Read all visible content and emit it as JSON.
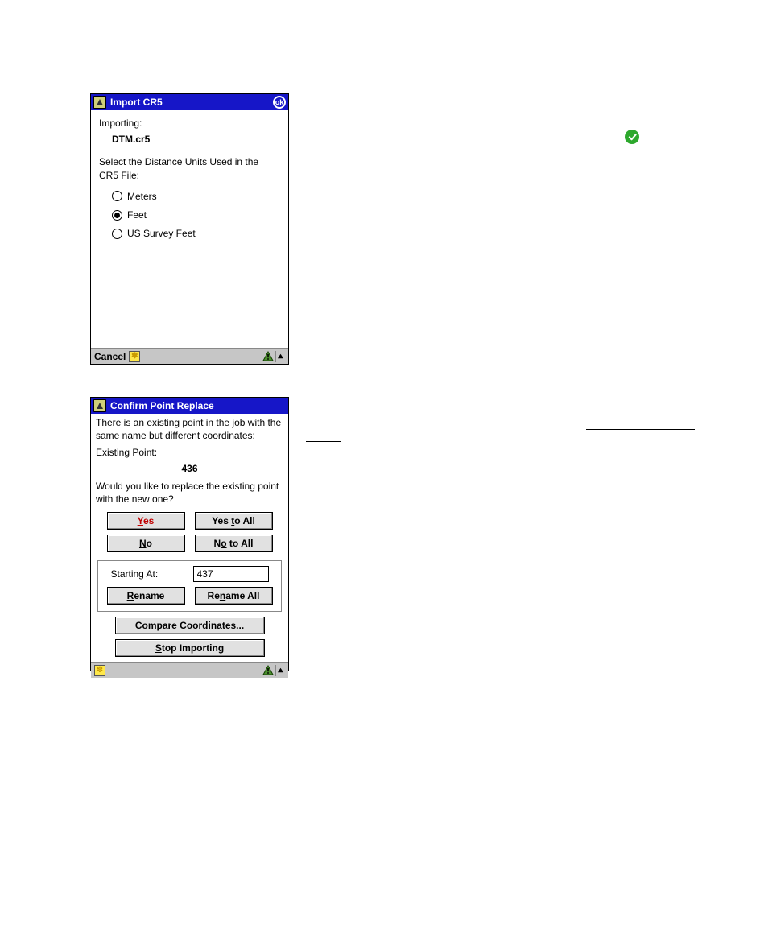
{
  "window1": {
    "title": "Import CR5",
    "ok": "ok",
    "importing_label": "Importing:",
    "filename": "DTM.cr5",
    "select_units_text": "Select the Distance Units Used in the CR5 File:",
    "options": {
      "meters": "Meters",
      "feet": "Feet",
      "us_survey": "US Survey Feet",
      "selected": "feet"
    },
    "cancel": "Cancel"
  },
  "window2": {
    "title": "Confirm Point Replace",
    "intro": "There is an existing point in the job with the same name but different coordinates:",
    "existing_label": "Existing Point:",
    "point": "436",
    "question": "Would you like to replace the existing point with the new one?",
    "buttons": {
      "yes": "Yes",
      "yes_all": "Yes to All",
      "no": "No",
      "no_all": "No to All",
      "rename": "Rename",
      "rename_all": "Rename All",
      "compare": "Compare Coordinates...",
      "stop": "Stop Importing"
    },
    "starting_at_label": "Starting At:",
    "starting_at_value": "437"
  },
  "icons": {
    "app": "app-icon",
    "ok": "ok-icon",
    "star": "star-icon",
    "warning": "warning-triangle-icon",
    "up": "up-arrow-icon",
    "check": "check-icon"
  }
}
